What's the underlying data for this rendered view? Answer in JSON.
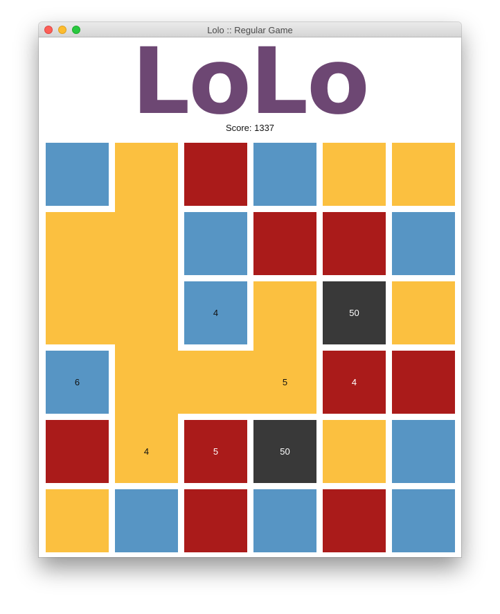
{
  "window": {
    "title": "Lolo :: Regular Game"
  },
  "header": {
    "logo": "LoLo",
    "score_label": "Score: 1337"
  },
  "colors": {
    "blue": "#5795c4",
    "yellow": "#fbc040",
    "red": "#aa1b1a",
    "dark": "#393939",
    "logo": "#6d4773"
  },
  "board": {
    "rows": [
      [
        {
          "color": "blue",
          "label": ""
        },
        {
          "color": "yellow",
          "label": ""
        },
        {
          "color": "red",
          "label": ""
        },
        {
          "color": "blue",
          "label": ""
        },
        {
          "color": "yellow",
          "label": ""
        },
        {
          "color": "yellow",
          "label": ""
        }
      ],
      [
        {
          "color": "yellow",
          "label": ""
        },
        {
          "color": "yellow",
          "label": ""
        },
        {
          "color": "blue",
          "label": ""
        },
        {
          "color": "red",
          "label": ""
        },
        {
          "color": "red",
          "label": ""
        },
        {
          "color": "blue",
          "label": ""
        }
      ],
      [
        {
          "color": "yellow",
          "label": ""
        },
        {
          "color": "yellow",
          "label": ""
        },
        {
          "color": "blue",
          "label": "4"
        },
        {
          "color": "yellow",
          "label": ""
        },
        {
          "color": "dark",
          "label": "50"
        },
        {
          "color": "yellow",
          "label": ""
        }
      ],
      [
        {
          "color": "blue",
          "label": "6"
        },
        {
          "color": "yellow",
          "label": ""
        },
        {
          "color": "yellow",
          "label": ""
        },
        {
          "color": "yellow",
          "label": "5"
        },
        {
          "color": "red",
          "label": "4"
        },
        {
          "color": "red",
          "label": ""
        }
      ],
      [
        {
          "color": "red",
          "label": ""
        },
        {
          "color": "yellow",
          "label": "4"
        },
        {
          "color": "red",
          "label": "5"
        },
        {
          "color": "dark",
          "label": "50"
        },
        {
          "color": "yellow",
          "label": ""
        },
        {
          "color": "blue",
          "label": ""
        }
      ],
      [
        {
          "color": "yellow",
          "label": ""
        },
        {
          "color": "blue",
          "label": ""
        },
        {
          "color": "red",
          "label": ""
        },
        {
          "color": "blue",
          "label": ""
        },
        {
          "color": "red",
          "label": ""
        },
        {
          "color": "blue",
          "label": ""
        }
      ]
    ],
    "selected_group": [
      [
        0,
        1
      ],
      [
        1,
        0
      ],
      [
        1,
        1
      ],
      [
        2,
        0
      ],
      [
        2,
        1
      ],
      [
        2,
        3
      ],
      [
        3,
        1
      ],
      [
        3,
        2
      ],
      [
        3,
        3
      ],
      [
        4,
        1
      ]
    ]
  }
}
